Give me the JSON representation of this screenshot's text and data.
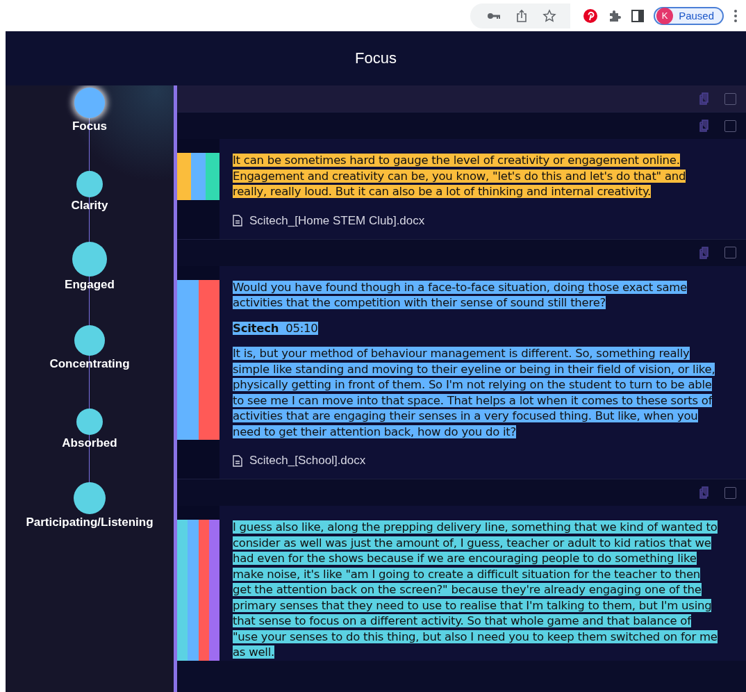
{
  "browser": {
    "profile_initial": "K",
    "profile_status": "Paused"
  },
  "header": {
    "title": "Focus"
  },
  "sidebar": {
    "items": [
      {
        "label": "Focus",
        "selected": true
      },
      {
        "label": "Clarity",
        "selected": false
      },
      {
        "label": "Engaged",
        "selected": false
      },
      {
        "label": "Concentrating",
        "selected": false
      },
      {
        "label": "Absorbed",
        "selected": false
      },
      {
        "label": "Participating/Listening",
        "selected": false
      }
    ]
  },
  "group_bar": {
    "checked": false
  },
  "cards": [
    {
      "checked": false,
      "stripes": [
        {
          "color": "#fbbd3c"
        },
        {
          "color": "#62b3ff"
        },
        {
          "color": "#32d9b0"
        }
      ],
      "color": "#fbbd3c",
      "source": "Scitech_[Home STEM Club].docx",
      "paragraphs": [
        {
          "kind": "text",
          "text": "It can be sometimes hard to gauge the level of creativity or engagement online. Engagement and creativity can be, you know, \"let's do this and let's do that\" and really, really loud. But it can also be a lot of thinking and internal creativity."
        }
      ]
    },
    {
      "checked": false,
      "stripes": [
        {
          "color": "#62b3ff"
        },
        {
          "color": "#ff5a57"
        }
      ],
      "color": "#62b3ff",
      "source": "Scitech_[School].docx",
      "paragraphs": [
        {
          "kind": "text",
          "text": "Would you have found though in a face-to-face situation, doing those exact same activities that the competition with their sense of sound still there?"
        },
        {
          "kind": "speaker",
          "name": "Scitech",
          "time": "05:10"
        },
        {
          "kind": "text",
          "text": "It is, but your method of behaviour management is different. So, something really simple like standing and moving to their eyeline or being in their field of vision, or like, physically getting in front of them. So I'm not relying on the student to turn to be able to see me I can move into that space. That helps a lot when it comes to these sorts of activities that are engaging their senses in a very focused thing. But like, when you need to get their attention back, how do you do it?"
        }
      ]
    },
    {
      "checked": false,
      "stripes": [
        {
          "color": "#5bd2e3"
        },
        {
          "color": "#62b3ff"
        },
        {
          "color": "#ff5a57"
        },
        {
          "color": "#9e6cf0"
        }
      ],
      "color": "#5bd2e3",
      "paragraphs": [
        {
          "kind": "text",
          "text": "I guess also like, along the prepping delivery line, something that we kind of wanted to consider as well was just the amount of, I guess, teacher or adult to kid ratios that we had even for the shows because if we are encouraging people to do something like make noise, it's like \"am I going to create a difficult situation for the teacher to then get the attention back on the screen?\" because they're already engaging one of the primary senses that they need to use to realise that I'm talking to them, but I'm using that sense to focus on a different activity. So that whole game and that balance of \"use your senses to do this thing, but also I need you to keep them switched on for me as well."
        }
      ]
    }
  ]
}
